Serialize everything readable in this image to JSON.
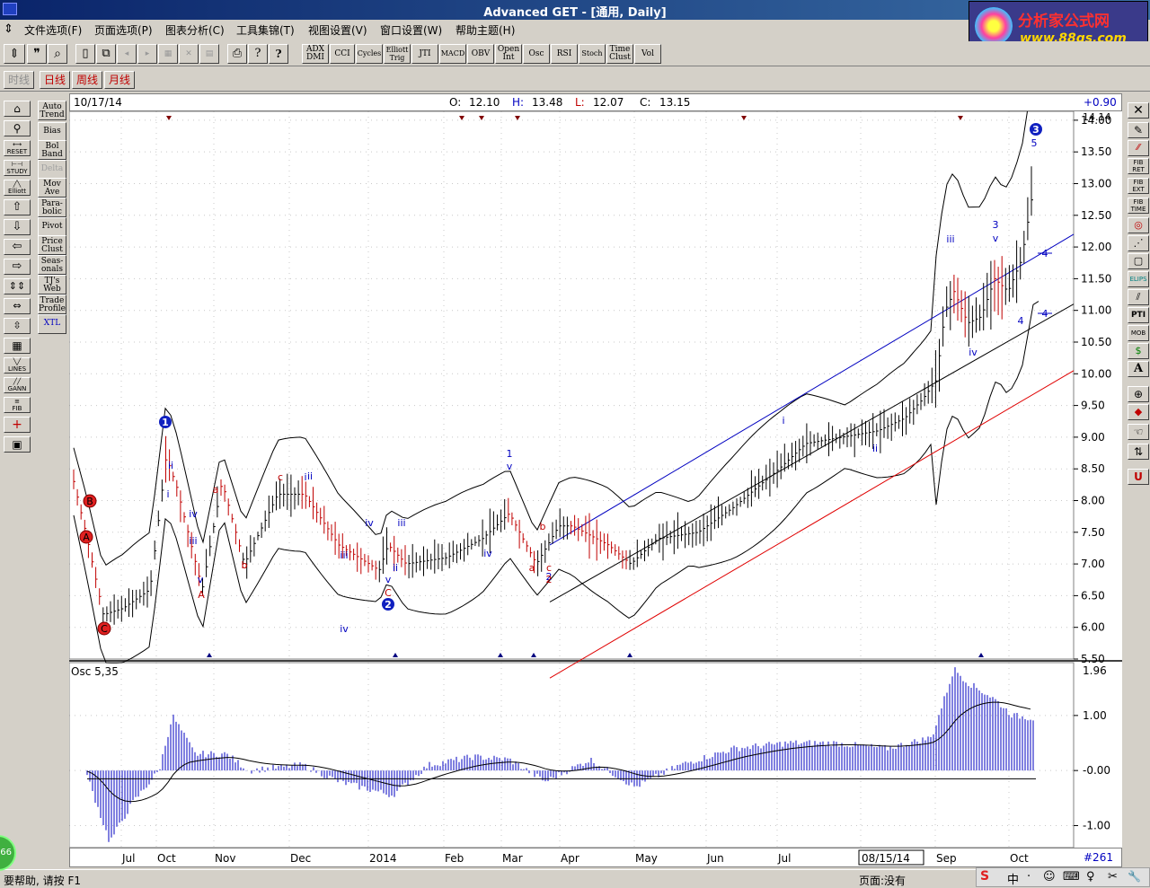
{
  "window": {
    "title": "Advanced GET - [通用, Daily]"
  },
  "logo": {
    "line1": "分析家公式网",
    "line2": "www.88gs.com"
  },
  "menu": {
    "items": [
      "文件选项(F)",
      "页面选项(P)",
      "图表分析(C)",
      "工具集锦(T)",
      "视图设置(V)",
      "窗口设置(W)",
      "帮助主题(H)"
    ]
  },
  "toolbar_studies": [
    "ADX DMI",
    "CCI",
    "Cycles",
    "Elliott Trig",
    "JTI",
    "MACD",
    "OBV",
    "Open Int",
    "Osc",
    "RSI",
    "Stoch",
    "Time Clust",
    "Vol"
  ],
  "timeframes": [
    "时线",
    "日线",
    "周线",
    "月线"
  ],
  "left_tools": [
    "RESET",
    "STUDY",
    "Elliott"
  ],
  "studies_panel": [
    "Auto Trend",
    "Bias",
    "Bol Band",
    "Delta",
    "Mov Ave",
    "Para-bolic",
    "Pivot",
    "Price Clust",
    "Seas-onals",
    "TJ's Web",
    "Trade Profile",
    "XTL"
  ],
  "left_tools_lower": [
    "LINES",
    "GANN",
    "FIB"
  ],
  "right_tools": [
    "FIB RET",
    "FIB EXT",
    "FIB TIME",
    "ELIPS",
    "PTI",
    "MOB",
    "A"
  ],
  "info": {
    "date": "10/17/14",
    "o_label": "O:",
    "o": "12.10",
    "h_label": "H:",
    "h": "13.48",
    "l_label": "L:",
    "l": "12.07",
    "c_label": "C:",
    "c": "13.15",
    "change": "+0.90"
  },
  "price_axis": {
    "top_label": "14.14",
    "ticks": [
      "14.00",
      "13.50",
      "13.00",
      "12.50",
      "12.00",
      "11.50",
      "11.00",
      "10.50",
      "10.00",
      "9.50",
      "9.00",
      "8.50",
      "8.00",
      "7.50",
      "7.00",
      "6.50",
      "6.00",
      "5.50"
    ],
    "range": [
      5.5,
      14.14
    ]
  },
  "osc": {
    "label": "Osc 5,35",
    "top_label": "1.96",
    "ticks": [
      "1.00",
      "-0.00",
      "-1.00"
    ],
    "range": [
      -1.4,
      1.96
    ]
  },
  "date_axis": {
    "labels": [
      "Jul",
      "Oct",
      "Nov",
      "Dec",
      "2014",
      "Feb",
      "Mar",
      "Apr",
      "May",
      "Jun",
      "Jul",
      "08/15/14",
      "Sep",
      "Oct"
    ],
    "bar_count": "#261"
  },
  "waves": {
    "blue": [
      "1",
      "i",
      "ii",
      "iii",
      "iv",
      "v",
      "2",
      "iii",
      "iv",
      "v",
      "ii",
      "i",
      "ii",
      "iii",
      "iv",
      "1",
      "v",
      "iv",
      "2",
      "i",
      "ii",
      "iii",
      "iv",
      "3",
      "v",
      "4",
      "5",
      "3"
    ],
    "red": [
      "B",
      "A",
      "C",
      "a",
      "b",
      "c",
      "b",
      "A",
      "C",
      "a",
      "b",
      "c",
      "2"
    ],
    "channel_labels": [
      "4",
      "4"
    ]
  },
  "status": {
    "help": "要帮助, 请按 F1",
    "page": "页面:没有"
  },
  "tray": {
    "items": [
      "S",
      "中",
      "·",
      "☺",
      "⌨",
      "♀",
      "✂",
      "🔧"
    ]
  },
  "colors": {
    "up": "#000000",
    "down": "#c00000",
    "wave_blue": "#0000c0",
    "wave_red": "#c00000",
    "channel_blue": "#0000c0",
    "channel_red": "#e00000"
  }
}
